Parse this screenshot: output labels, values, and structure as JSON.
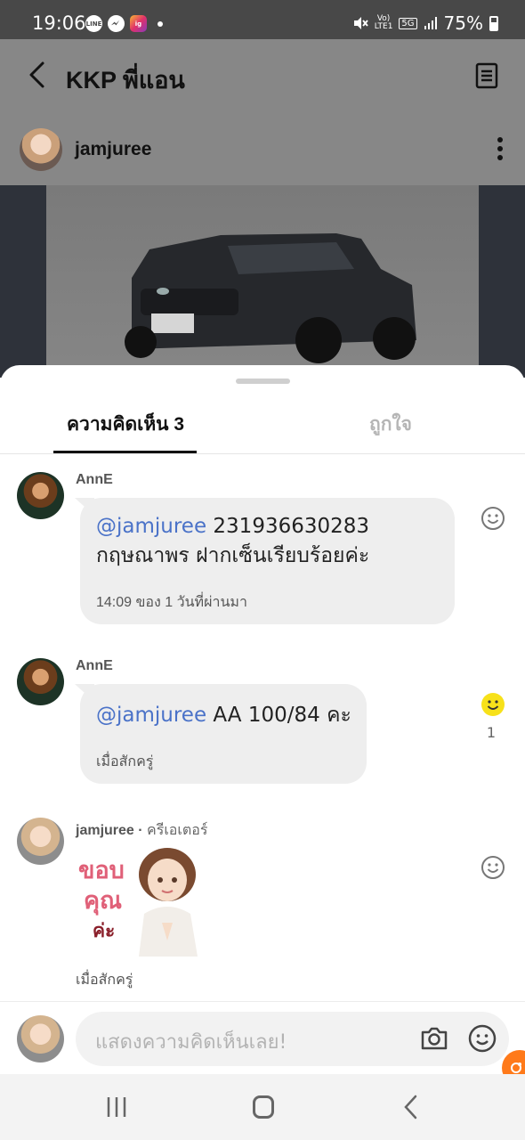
{
  "status_bar": {
    "time": "19:06",
    "app_icons": [
      "LINE",
      "messenger-icon",
      "ig-icon"
    ],
    "network_volte": "Vo)",
    "network_lte": "LTE1",
    "network_5g": "5G",
    "battery": "75%"
  },
  "header": {
    "title": "KKP พี่แอน"
  },
  "post": {
    "author": "jamjuree"
  },
  "tabs": {
    "comments": "ความคิดเห็น 3",
    "likes": "ถูกใจ"
  },
  "comments": [
    {
      "author": "AnnE",
      "mention": "@jamjuree",
      "text_line1": " 231936630283",
      "text_line2": "กฤษณาพร ฝากเซ็นเรียบร้อยค่ะ",
      "time": "14:09 ของ 1 วันที่ผ่านมา",
      "reaction_count": ""
    },
    {
      "author": "AnnE",
      "mention": "@jamjuree",
      "text_line1": "  AA 100/84 คะ",
      "time": "เมื่อสักครู่",
      "reaction_count": "1"
    },
    {
      "author": "jamjuree",
      "badge": "ครีเอเตอร์",
      "sticker_text": [
        "ขอบ",
        "คุณ",
        "ค่ะ"
      ],
      "time": "เมื่อสักครู่"
    }
  ],
  "input": {
    "placeholder": "แสดงความคิดเห็นเลย!"
  },
  "colors": {
    "mention": "#4a72c8",
    "reaction_active": "#f7e11a",
    "fab": "#ff7a1a"
  }
}
